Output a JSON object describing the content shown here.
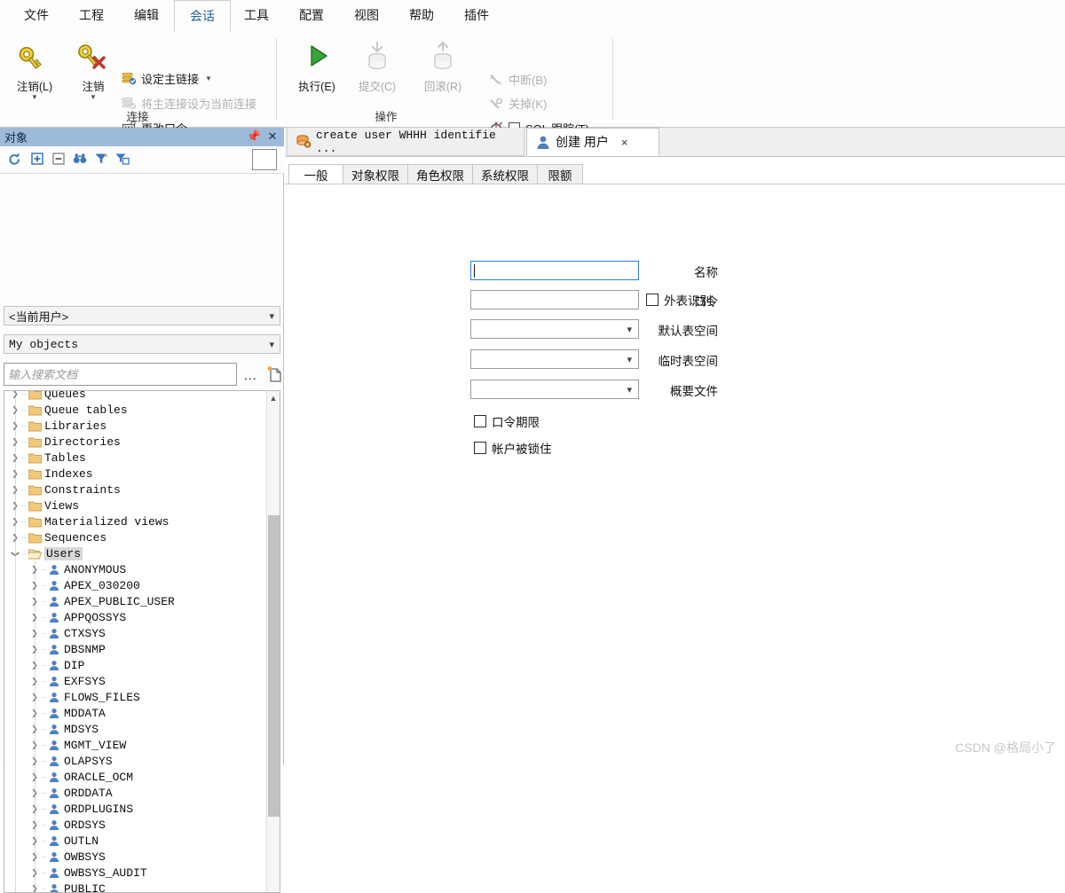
{
  "menubar": {
    "items": [
      {
        "label": "文件",
        "active": false
      },
      {
        "label": "工程",
        "active": false
      },
      {
        "label": "编辑",
        "active": false
      },
      {
        "label": "会话",
        "active": true
      },
      {
        "label": "工具",
        "active": false
      },
      {
        "label": "配置",
        "active": false
      },
      {
        "label": "视图",
        "active": false
      },
      {
        "label": "帮助",
        "active": false
      },
      {
        "label": "插件",
        "active": false
      }
    ]
  },
  "ribbon": {
    "groups": [
      {
        "label": "连接"
      },
      {
        "label": "操作"
      }
    ],
    "connection_group": {
      "label": "连接",
      "logoff_button": {
        "label": "注销(L)",
        "icon": "key-icon",
        "enabled": true
      },
      "logoff_all_button": {
        "label": "注销",
        "icon": "key-delete-icon",
        "enabled": true
      },
      "set_main_connection": {
        "label": "设定主链接",
        "icon": "database-check-icon",
        "enabled": true
      },
      "set_main_as_current": {
        "label": "将主连接设为当前连接",
        "icon": "database-check-disabled-icon",
        "enabled": false
      },
      "change_password": {
        "label": "更改口令...",
        "icon": "password-icon",
        "enabled": true
      }
    },
    "operation_group": {
      "label": "操作",
      "execute_button": {
        "label": "执行(E)",
        "icon": "play-icon",
        "enabled": true
      },
      "commit_button": {
        "label": "提交(C)",
        "icon": "commit-icon",
        "enabled": false
      },
      "rollback_button": {
        "label": "回滚(R)",
        "icon": "rollback-icon",
        "enabled": false
      },
      "break_item": {
        "label": "中断(B)",
        "icon": "break-icon",
        "enabled": false
      },
      "kill_item": {
        "label": "关掉(K)",
        "icon": "kill-icon",
        "enabled": false
      },
      "sql_trace_item": {
        "label": "SQL 跟踪(T)",
        "icon": "stopwatch-icon",
        "checked": false,
        "enabled": true
      }
    }
  },
  "object_panel": {
    "title": "对象",
    "pin_icon": "pin-icon",
    "close_icon": "close-icon",
    "toolbar": [
      {
        "name": "refresh-icon"
      },
      {
        "name": "expand-all-icon"
      },
      {
        "name": "collapse-all-icon"
      },
      {
        "name": "find-icon"
      },
      {
        "name": "filter-icon"
      },
      {
        "name": "filter-document-icon"
      }
    ],
    "user_select": {
      "value": "<当前用户>"
    },
    "object_select": {
      "value": "My objects"
    },
    "search": {
      "placeholder": "输入搜索文档",
      "value": ""
    },
    "ellipsis_button": "...",
    "new_document_icon": "new-document-icon",
    "tree": {
      "folders": [
        "Queues",
        "Queue tables",
        "Libraries",
        "Directories",
        "Tables",
        "Indexes",
        "Constraints",
        "Views",
        "Materialized views",
        "Sequences"
      ],
      "selected_folder": "Users",
      "users": [
        "ANONYMOUS",
        "APEX_030200",
        "APEX_PUBLIC_USER",
        "APPQOSSYS",
        "CTXSYS",
        "DBSNMP",
        "DIP",
        "EXFSYS",
        "FLOWS_FILES",
        "MDDATA",
        "MDSYS",
        "MGMT_VIEW",
        "OLAPSYS",
        "ORACLE_OCM",
        "ORDDATA",
        "ORDPLUGINS",
        "ORDSYS",
        "OUTLN",
        "OWBSYS",
        "OWBSYS_AUDIT",
        "PUBLIC"
      ]
    }
  },
  "editor": {
    "document_tabs": [
      {
        "label": "create user WHHH identifie ...",
        "icon": "sql-database-icon",
        "active": false,
        "closable": false
      },
      {
        "label": "创建 用户",
        "icon": "user-icon",
        "active": true,
        "closable": true,
        "close_label": "×"
      }
    ],
    "sub_tabs": [
      {
        "label": "一般",
        "active": true
      },
      {
        "label": "对象权限",
        "active": false
      },
      {
        "label": "角色权限",
        "active": false
      },
      {
        "label": "系统权限",
        "active": false
      },
      {
        "label": "限额",
        "active": false
      }
    ],
    "form": {
      "fields": [
        {
          "label": "名称",
          "type": "text",
          "value": "",
          "focused": true
        },
        {
          "label": "口令",
          "type": "text",
          "value": "",
          "focused": false
        },
        {
          "label": "默认表空间",
          "type": "select",
          "value": ""
        },
        {
          "label": "临时表空间",
          "type": "select",
          "value": ""
        },
        {
          "label": "概要文件",
          "type": "select",
          "value": ""
        }
      ],
      "external_identify": {
        "label": "外表识别",
        "checked": false
      },
      "checkboxes": [
        {
          "label": "口令期限",
          "checked": false
        },
        {
          "label": "帐户被锁住",
          "checked": false
        }
      ]
    }
  },
  "watermark": "CSDN @格局小了",
  "colors": {
    "accent_blue": "#2a6099",
    "panel_header": "#9dbada",
    "focus_border": "#2a7fd4",
    "folder_yellow": "#f2c97c",
    "user_blue": "#4f81bd",
    "execute_green": "#2f9e2f"
  }
}
